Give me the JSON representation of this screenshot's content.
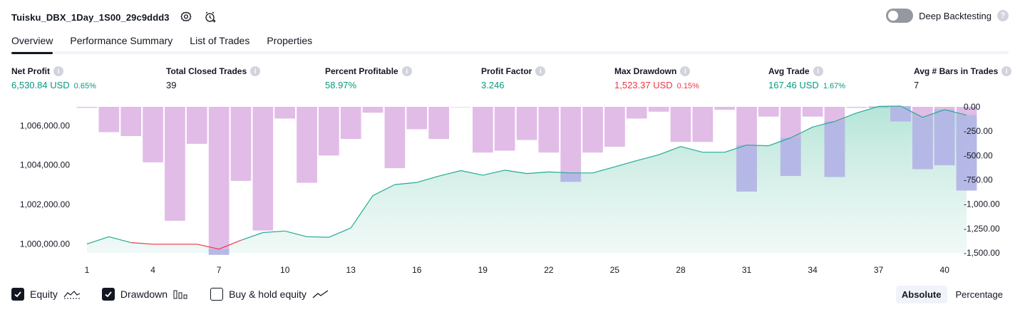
{
  "header": {
    "strategy_name": "Tuisku_DBX_1Day_1S00_29c9ddd3",
    "settings_icon": "gear-icon",
    "alert_icon": "alarm-clock-plus-icon"
  },
  "deep_backtesting": {
    "label": "Deep Backtesting",
    "enabled": false,
    "help": "?"
  },
  "tabs": [
    {
      "label": "Overview",
      "active": true
    },
    {
      "label": "Performance Summary",
      "active": false
    },
    {
      "label": "List of Trades",
      "active": false
    },
    {
      "label": "Properties",
      "active": false
    }
  ],
  "metrics": {
    "net_profit": {
      "label": "Net Profit",
      "value": "6,530.84 USD",
      "pct": "0.65%"
    },
    "total_closed_trades": {
      "label": "Total Closed Trades",
      "value": "39"
    },
    "percent_profitable": {
      "label": "Percent Profitable",
      "value": "58.97%"
    },
    "profit_factor": {
      "label": "Profit Factor",
      "value": "3.246"
    },
    "max_drawdown": {
      "label": "Max Drawdown",
      "value": "1,523.37 USD",
      "pct": "0.15%"
    },
    "avg_trade": {
      "label": "Avg Trade",
      "value": "167.46 USD",
      "pct": "1.67%"
    },
    "avg_bars": {
      "label": "Avg # Bars in Trades",
      "value": "7"
    },
    "info_glyph": "i"
  },
  "chart_data": {
    "type": "area",
    "x_ticks": [
      "1",
      "4",
      "7",
      "10",
      "13",
      "16",
      "19",
      "22",
      "25",
      "28",
      "31",
      "34",
      "37",
      "40"
    ],
    "left_axis": {
      "ticks": [
        "1,006,000.00",
        "1,004,000.00",
        "1,002,000.00",
        "1,000,000.00"
      ],
      "tick_values": [
        1006000,
        1004000,
        1002000,
        1000000
      ],
      "ylim": [
        999550,
        1006950
      ]
    },
    "right_axis": {
      "ticks": [
        "0.00",
        "-250.00",
        "-500.00",
        "-750.00",
        "-1,000.00",
        "-1,250.00",
        "-1,500.00"
      ],
      "tick_values": [
        0,
        -250,
        -500,
        -750,
        -1000,
        -1250,
        -1500
      ],
      "ylim": [
        -1500,
        0
      ]
    },
    "series": [
      {
        "name": "Equity",
        "color": "#22ab94",
        "fill": "#c9ece3",
        "values": [
          1000000,
          1000370,
          1000070,
          999990,
          999990,
          999990,
          999740,
          1000190,
          1000580,
          1000660,
          1000370,
          1000340,
          1000810,
          1002450,
          1003010,
          1003120,
          1003440,
          1003720,
          1003490,
          1003740,
          1003570,
          1003650,
          1003600,
          1003600,
          1003910,
          1004230,
          1004520,
          1004940,
          1004650,
          1004650,
          1005010,
          1004980,
          1005380,
          1005930,
          1006210,
          1006640,
          1006970,
          1006990,
          1006420,
          1006810,
          1006530
        ]
      },
      {
        "name": "Drawdown",
        "color": "#ce93d8",
        "values": [
          -10,
          -260,
          -300,
          -570,
          -1170,
          -380,
          -1520,
          -760,
          -1270,
          -120,
          -780,
          -500,
          -330,
          -60,
          -630,
          -230,
          -330,
          0,
          -470,
          -450,
          -340,
          -470,
          -770,
          -470,
          -410,
          -120,
          -50,
          -360,
          -360,
          -30,
          -870,
          -100,
          -710,
          -100,
          -720,
          -10,
          -10,
          -150,
          -640,
          -600,
          -860
        ]
      }
    ],
    "drawdown_overlap_color": "#b3b8e6",
    "equity_below_start_color": "#f23645"
  },
  "legend": {
    "items": [
      {
        "label": "Equity",
        "checked": true,
        "icon": "equity-line-icon"
      },
      {
        "label": "Drawdown",
        "checked": true,
        "icon": "drawdown-bars-icon"
      },
      {
        "label": "Buy & hold equity",
        "checked": false,
        "icon": "buy-hold-line-icon"
      }
    ]
  },
  "modes": [
    {
      "label": "Absolute",
      "active": true
    },
    {
      "label": "Percentage",
      "active": false
    }
  ]
}
